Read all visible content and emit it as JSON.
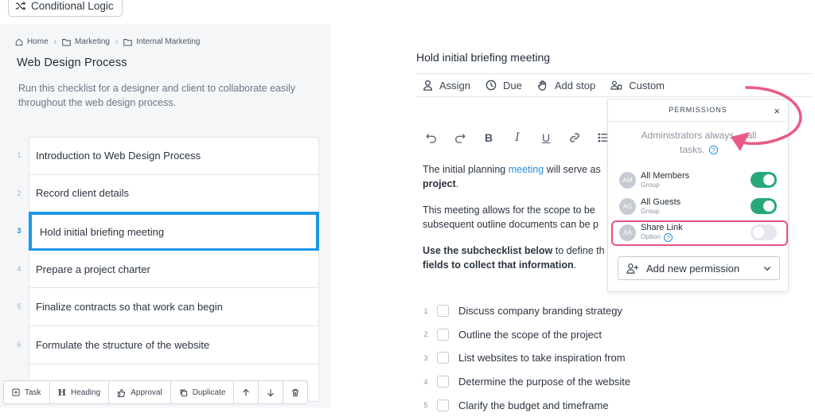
{
  "toolbar": {
    "conditional_logic": "Conditional Logic"
  },
  "breadcrumb": [
    "Home",
    "Marketing",
    "Internal Marketing"
  ],
  "checklist": {
    "title": "Web Design Process",
    "description": "Run this checklist for a designer and client to collaborate easily throughout the web design process."
  },
  "tasks": [
    {
      "num": "1",
      "label": "Introduction to Web Design Process"
    },
    {
      "num": "2",
      "label": "Record client details"
    },
    {
      "num": "3",
      "label": "Hold initial briefing meeting",
      "active": true
    },
    {
      "num": "4",
      "label": "Prepare a project charter"
    },
    {
      "num": "5",
      "label": "Finalize contracts so that work can begin"
    },
    {
      "num": "6",
      "label": "Formulate the structure of the website"
    }
  ],
  "bottom_bar": {
    "task": "Task",
    "heading": "Heading",
    "approval": "Approval",
    "duplicate": "Duplicate"
  },
  "task_detail": {
    "title": "Hold initial briefing meeting",
    "actions": {
      "assign": "Assign",
      "due": "Due",
      "add_stop": "Add stop",
      "custom": "Custom"
    },
    "p1_a": "The initial planning ",
    "p1_link": "meeting",
    "p1_b": " will serve as",
    "p1_bold": "project",
    "p1_end": ".",
    "p2": "This meeting allows for the scope to be subsequent outline documents can be p",
    "p3_bold1": "Use the subchecklist below",
    "p3_mid": " to define th",
    "p3_bold2": "fields to collect that information",
    "p3_end": "."
  },
  "subchecklist": [
    {
      "num": "1",
      "label": "Discuss company branding strategy"
    },
    {
      "num": "2",
      "label": "Outline the scope of the project"
    },
    {
      "num": "3",
      "label": "List websites to take inspiration from"
    },
    {
      "num": "4",
      "label": "Determine the purpose of the website"
    },
    {
      "num": "5",
      "label": "Clarify the budget and timeframe"
    }
  ],
  "permissions": {
    "header": "PERMISSIONS",
    "close": "×",
    "note_a": "Administrators always",
    "note_b": "all",
    "note_c": "tasks.",
    "help": "?",
    "rows": [
      {
        "initials": "AM",
        "name": "All Members",
        "type": "Group",
        "enabled": true
      },
      {
        "initials": "AG",
        "name": "All Guests",
        "type": "Group",
        "enabled": true
      },
      {
        "initials": "AA",
        "name": "Share Link",
        "type": "Option",
        "enabled": false
      }
    ],
    "add_label": "Add new permission"
  },
  "colors": {
    "accent_blue": "#1f97e6",
    "toggle_green": "#28a879",
    "highlight_pink": "#e5557d"
  },
  "icons": [
    "shuffle-icon",
    "home-icon",
    "folder-icon",
    "user-icon",
    "clock-icon",
    "hand-icon",
    "user-group-icon",
    "undo-icon",
    "redo-icon",
    "bold-icon",
    "italic-icon",
    "underline-icon",
    "link-icon",
    "list-icon",
    "close-icon",
    "help-icon",
    "add-user-icon",
    "chevron-down-icon",
    "plus-square-icon",
    "approval-icon",
    "duplicate-icon",
    "arrow-up-icon",
    "arrow-down-icon",
    "trash-icon"
  ]
}
